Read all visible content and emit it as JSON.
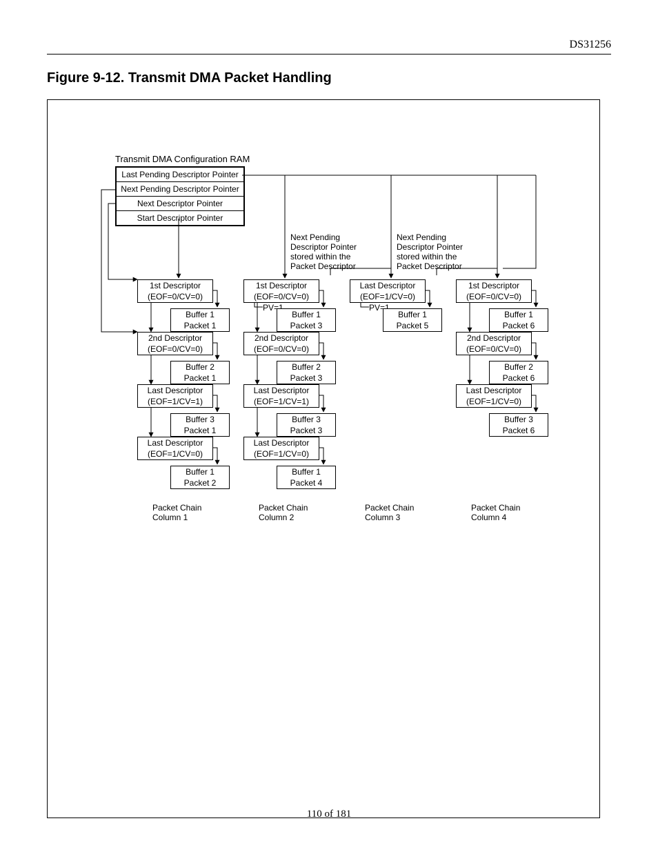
{
  "doc_id": "DS31256",
  "figure_title": "Figure 9-12. Transmit DMA Packet Handling",
  "footer": "110 of 181",
  "config_ram": {
    "title": "Transmit DMA Configuration RAM",
    "rows": [
      "Last Pending Descriptor Pointer",
      "Next Pending Descriptor Pointer",
      "Next Descriptor Pointer",
      "Start Descriptor Pointer"
    ]
  },
  "pending_note_a": "Next Pending\nDescriptor Pointer\nstored within the\nPacket Descriptor",
  "pending_note_b": "Next Pending\nDescriptor Pointer\nstored within the\nPacket Descriptor",
  "pv_label": "PV=1",
  "columns": [
    {
      "label": "Packet Chain\nColumn 1",
      "packet_short": [
        "Packet 1",
        "Packet 2"
      ],
      "chain": [
        {
          "desc": [
            "1st Descriptor",
            "(EOF=0/CV=0)"
          ],
          "buf": [
            "Buffer 1",
            "Packet 1"
          ]
        },
        {
          "desc": [
            "2nd Descriptor",
            "(EOF=0/CV=0)"
          ],
          "buf": [
            "Buffer 2",
            "Packet 1"
          ]
        },
        {
          "desc": [
            "Last Descriptor",
            "(EOF=1/CV=1)"
          ],
          "buf": [
            "Buffer 3",
            "Packet 1"
          ]
        },
        {
          "desc": [
            "Last Descriptor",
            "(EOF=1/CV=0)"
          ],
          "buf": [
            "Buffer 1",
            "Packet 2"
          ]
        }
      ]
    },
    {
      "label": "Packet Chain\nColumn 2",
      "packet_short": [
        "Packet 3",
        "Packet 4"
      ],
      "chain": [
        {
          "desc": [
            "1st Descriptor",
            "(EOF=0/CV=0)"
          ],
          "buf": [
            "Buffer 1",
            "Packet 3"
          ]
        },
        {
          "desc": [
            "2nd Descriptor",
            "(EOF=0/CV=0)"
          ],
          "buf": [
            "Buffer 2",
            "Packet 3"
          ]
        },
        {
          "desc": [
            "Last Descriptor",
            "(EOF=1/CV=1)"
          ],
          "buf": [
            "Buffer 3",
            "Packet 3"
          ]
        },
        {
          "desc": [
            "Last Descriptor",
            "(EOF=1/CV=0)"
          ],
          "buf": [
            "Buffer 1",
            "Packet 4"
          ]
        }
      ]
    },
    {
      "label": "Packet Chain\nColumn 3",
      "packet_short": [
        "Packet 5"
      ],
      "chain": [
        {
          "desc": [
            "Last Descriptor",
            "(EOF=1/CV=0)"
          ],
          "buf": [
            "Buffer 1",
            "Packet 5"
          ]
        }
      ]
    },
    {
      "label": "Packet Chain\nColumn 4",
      "packet_short": [
        "Packet 6"
      ],
      "chain": [
        {
          "desc": [
            "1st Descriptor",
            "(EOF=0/CV=0)"
          ],
          "buf": [
            "Buffer 1",
            "Packet 6"
          ]
        },
        {
          "desc": [
            "2nd Descriptor",
            "(EOF=0/CV=0)"
          ],
          "buf": [
            "Buffer 2",
            "Packet 6"
          ]
        },
        {
          "desc": [
            "Last Descriptor",
            "(EOF=1/CV=0)"
          ],
          "buf": [
            "Buffer 3",
            "Packet 6"
          ]
        }
      ]
    }
  ]
}
